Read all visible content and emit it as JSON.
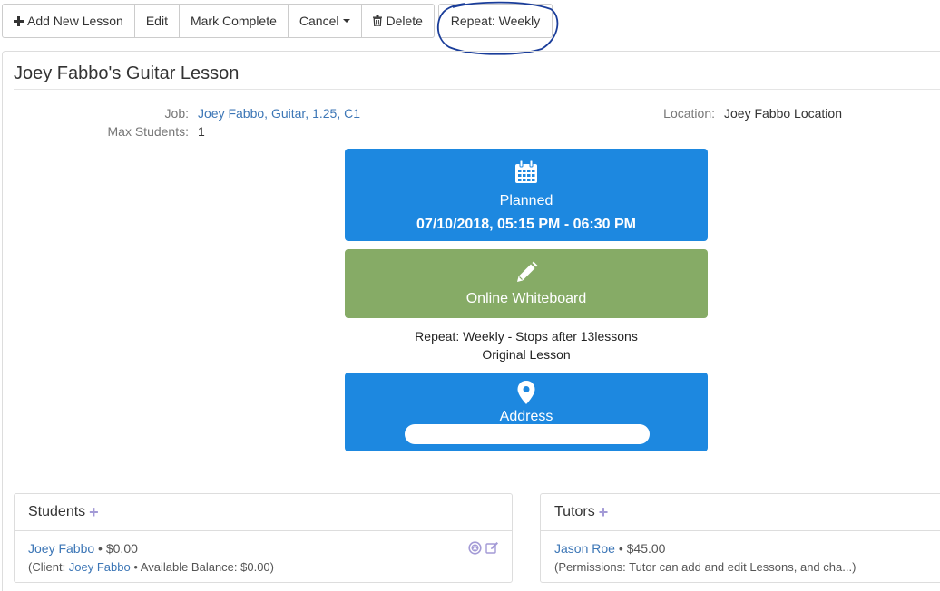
{
  "toolbar": {
    "add_label": "Add New Lesson",
    "edit_label": "Edit",
    "complete_label": "Mark Complete",
    "cancel_label": "Cancel",
    "delete_label": "Delete",
    "repeat_label": "Repeat: Weekly"
  },
  "lesson": {
    "title": "Joey Fabbo's Guitar Lesson",
    "job_label": "Job:",
    "job_value": "Joey Fabbo, Guitar, 1.25, C1",
    "max_students_label": "Max Students:",
    "max_students_value": "1",
    "location_label": "Location:",
    "location_value": "Joey Fabbo Location"
  },
  "status_card": {
    "icon": "calendar-icon",
    "status": "Planned",
    "datetime": "07/10/2018, 05:15 PM - 06:30 PM"
  },
  "whiteboard_card": {
    "icon": "pencil-icon",
    "label": "Online Whiteboard"
  },
  "repeat_info": {
    "line1": "Repeat: Weekly - Stops after 13lessons",
    "line2": "Original Lesson"
  },
  "address_card": {
    "icon": "map-marker-icon",
    "label": "Address"
  },
  "students": {
    "heading": "Students",
    "name": "Joey Fabbo",
    "amount": " • $0.00",
    "client_prefix": "(Client: ",
    "client_name": "Joey Fabbo",
    "client_suffix": " • Available Balance: $0.00)"
  },
  "tutors": {
    "heading": "Tutors",
    "name": "Jason Roe",
    "amount": " • $45.00",
    "permissions": "(Permissions: Tutor can add and edit Lessons, and cha...)"
  },
  "colors": {
    "blue_card": "#1d88e0",
    "green_card": "#86ab66",
    "link": "#3c76b6",
    "plus": "#a39ad6",
    "annotation": "#1a3d9a"
  }
}
